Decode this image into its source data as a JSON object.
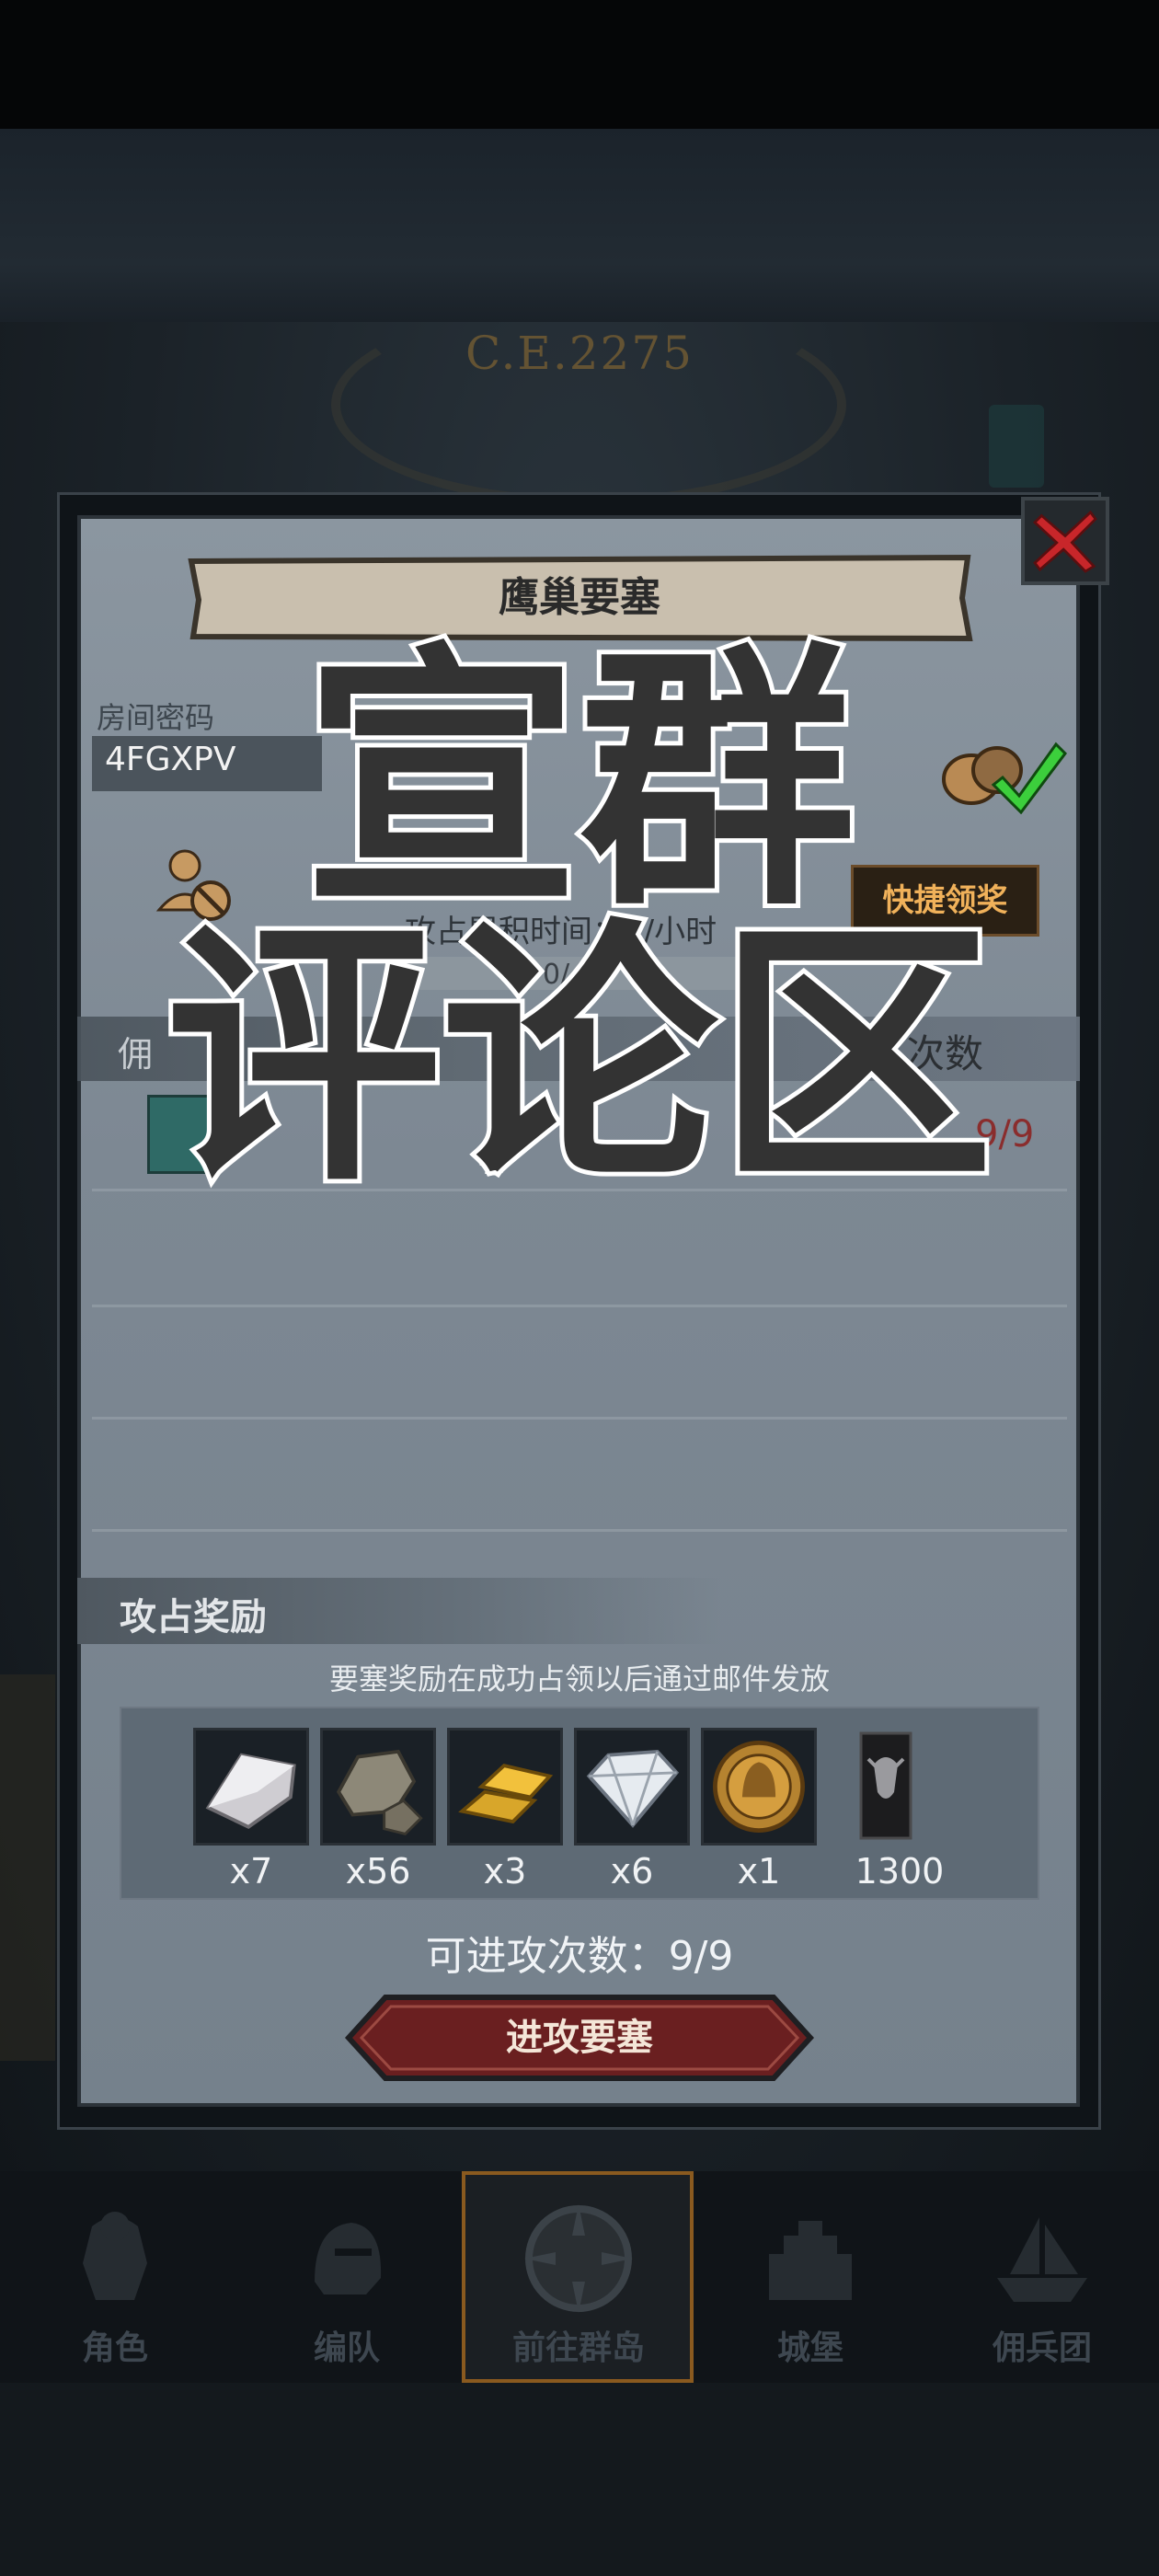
{
  "background": {
    "era_label": "C.E.2275"
  },
  "modal": {
    "title": "鹰巢要塞",
    "room_code_label": "房间密码",
    "room_code": "4FGXPV",
    "quick_claim": "快捷领奖",
    "time_text": "攻占累积时间：2/小时",
    "progress_text": "0/",
    "merc_label": "佣",
    "attack_count_header": "次数",
    "merc_count": "9/9",
    "reward_title": "攻占奖励",
    "reward_note": "要塞奖励在成功占领以后通过邮件发放",
    "rewards": [
      {
        "icon": "silver-ingot-icon",
        "count": "x7"
      },
      {
        "icon": "stone-ore-icon",
        "count": "x56"
      },
      {
        "icon": "gold-bar-icon",
        "count": "x3"
      },
      {
        "icon": "diamond-icon",
        "count": "x6"
      },
      {
        "icon": "knight-medal-icon",
        "count": "x1"
      },
      {
        "icon": "bull-banner-icon",
        "count": "1300"
      }
    ],
    "attack_count_line": "可进攻次数：9/9",
    "attack_button": "进攻要塞"
  },
  "nav": [
    {
      "label": "角色",
      "icon": "armor-icon"
    },
    {
      "label": "编队",
      "icon": "helmet-icon"
    },
    {
      "label": "前往群岛",
      "icon": "compass-icon",
      "active": true
    },
    {
      "label": "城堡",
      "icon": "castle-icon"
    },
    {
      "label": "佣兵团",
      "icon": "ship-icon"
    }
  ],
  "watermark": {
    "line1": "宣群",
    "line2": "评论区"
  }
}
